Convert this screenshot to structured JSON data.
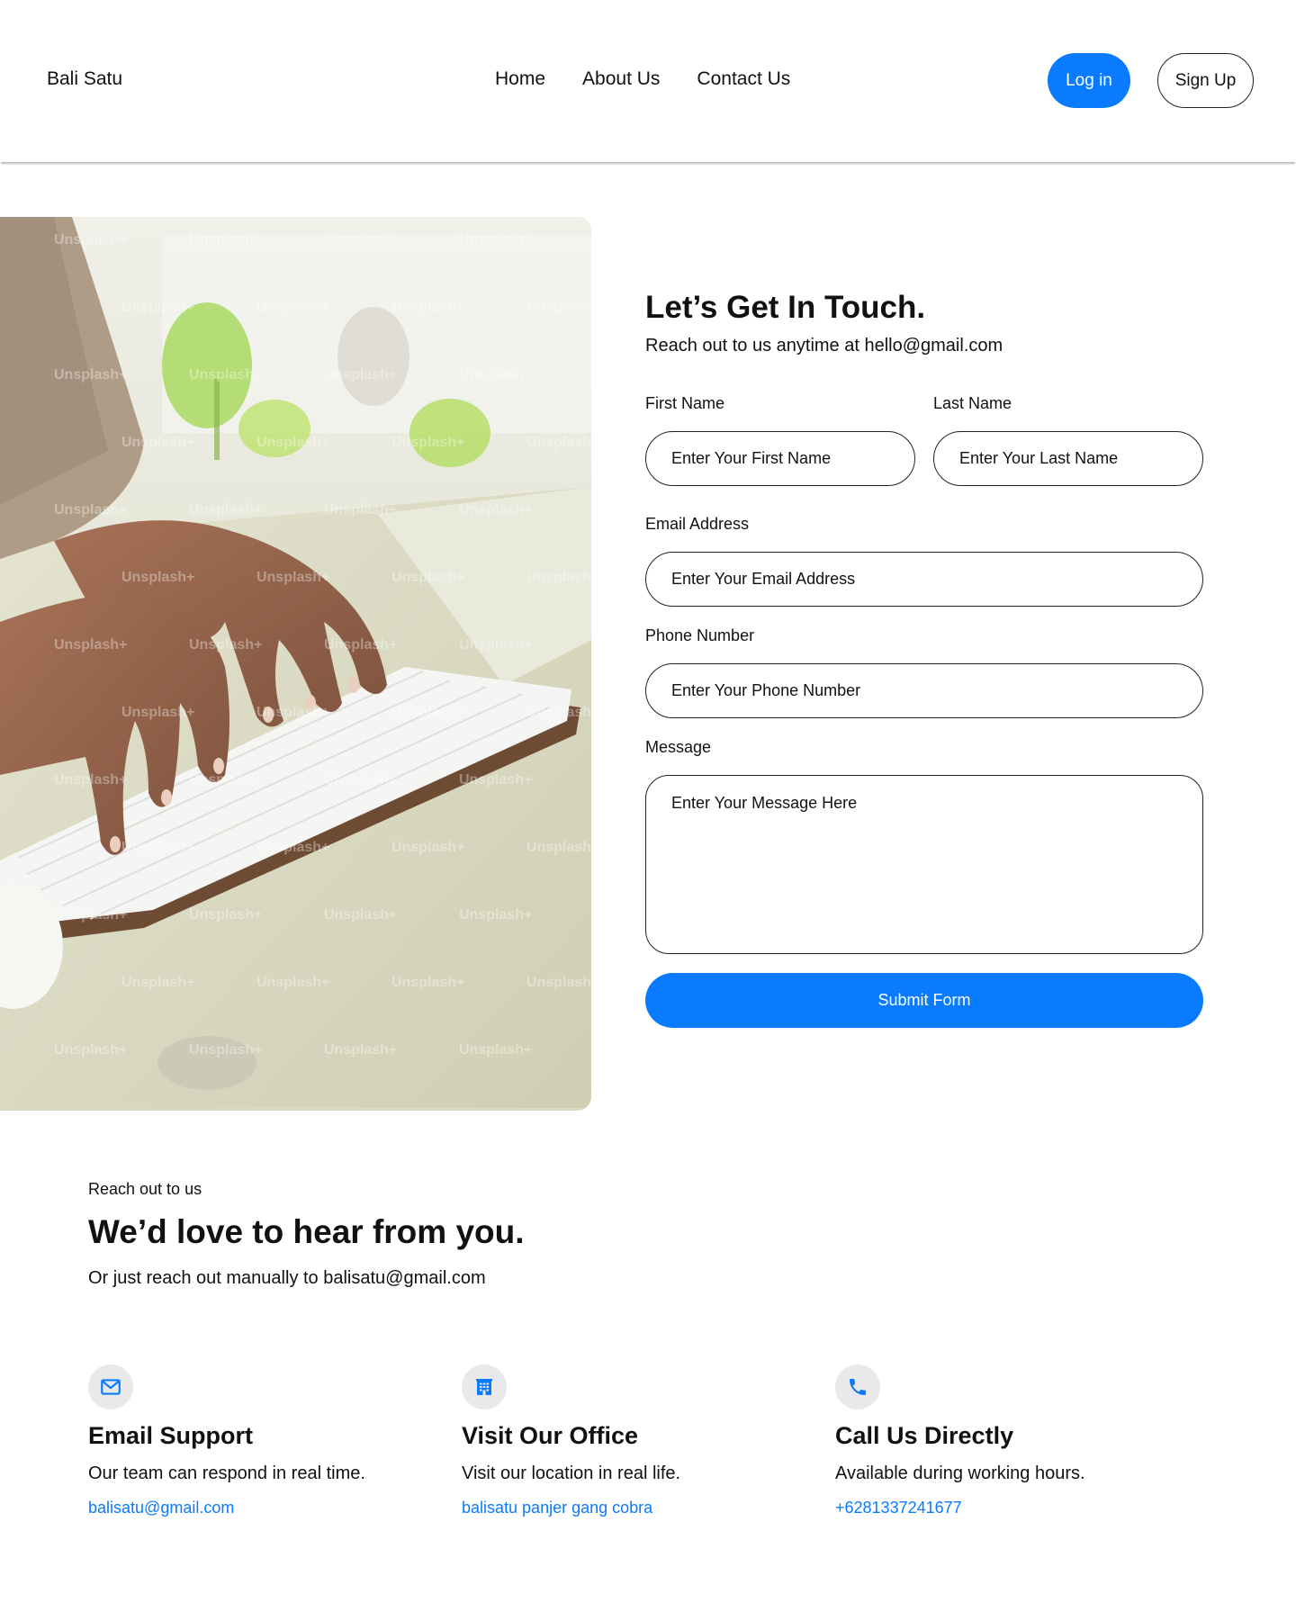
{
  "header": {
    "brand": "Bali Satu",
    "nav": [
      "Home",
      "About Us",
      "Contact Us"
    ],
    "login_label": "Log in",
    "signup_label": "Sign Up"
  },
  "photo": {
    "watermark": "Unsplash+"
  },
  "form": {
    "title": "Let’s Get In Touch.",
    "subtitle": "Reach out to us anytime at hello@gmail.com",
    "first_name": {
      "label": "First Name",
      "placeholder": "Enter Your First Name"
    },
    "last_name": {
      "label": "Last Name",
      "placeholder": "Enter Your Last Name"
    },
    "email": {
      "label": "Email Address",
      "placeholder": "Enter Your Email Address"
    },
    "phone": {
      "label": "Phone Number",
      "placeholder": "Enter Your Phone Number"
    },
    "message": {
      "label": "Message",
      "placeholder": "Enter Your Message Here"
    },
    "submit_label": "Submit Form"
  },
  "reach": {
    "kicker": "Reach out to us",
    "title": "We’d love to hear from you.",
    "subtitle": "Or just reach out manually to balisatu@gmail.com"
  },
  "cards": [
    {
      "icon": "mail-icon",
      "title": "Email Support",
      "desc": "Our team can respond in real time.",
      "link": "balisatu@gmail.com"
    },
    {
      "icon": "building-icon",
      "title": "Visit Our Office",
      "desc": "Visit our location in real life.",
      "link": "balisatu panjer gang cobra"
    },
    {
      "icon": "phone-icon",
      "title": "Call Us Directly",
      "desc": "Available during working hours.",
      "link": "+6281337241677"
    }
  ],
  "colors": {
    "accent": "#0a7bff",
    "icon_bg": "#e9e9ec",
    "text": "#111111"
  }
}
